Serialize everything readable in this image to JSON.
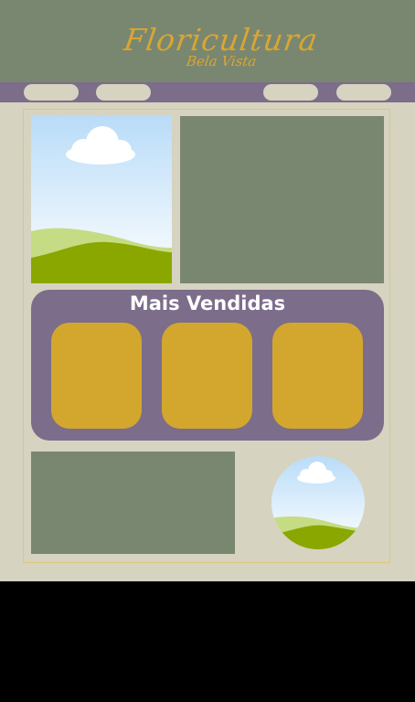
{
  "header": {
    "logo_main": "Floricultura",
    "logo_sub": "Bela Vista",
    "bg_color": "#798670",
    "logo_color": "#d8a632"
  },
  "nav": {
    "bg_color": "#7c6e8a",
    "button_color": "#d6d3c0",
    "buttons": [
      "",
      "",
      "",
      ""
    ]
  },
  "hero": {
    "image_icon": "landscape-placeholder-icon",
    "panel_color": "#798670"
  },
  "best_sellers": {
    "title": "Mais Vendidas",
    "bg_color": "#7c6e8a",
    "product_color": "#d3a62d",
    "products": [
      "",
      "",
      ""
    ]
  },
  "footer_area": {
    "panel_color": "#798670",
    "image_icon": "landscape-placeholder-icon"
  },
  "page": {
    "bg_color": "#d6d3c0",
    "border_color": "#d9c978"
  }
}
